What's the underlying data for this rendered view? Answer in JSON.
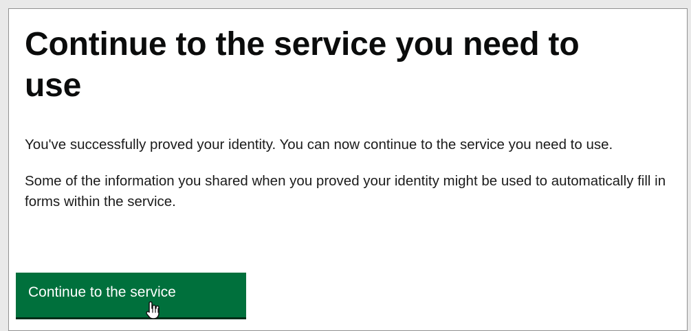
{
  "page": {
    "heading": "Continue to the service you need to use",
    "paragraph_1": "You've successfully proved your identity. You can now continue to the service you need to use.",
    "paragraph_2": "Some of the information you shared when you proved your identity might be used to automatically fill in forms within the service.",
    "continue_button_label": "Continue to the service"
  },
  "colors": {
    "button_green": "#00703c",
    "text": "#0b0c0c"
  },
  "icons": {
    "cursor": "hand-pointer-icon"
  }
}
